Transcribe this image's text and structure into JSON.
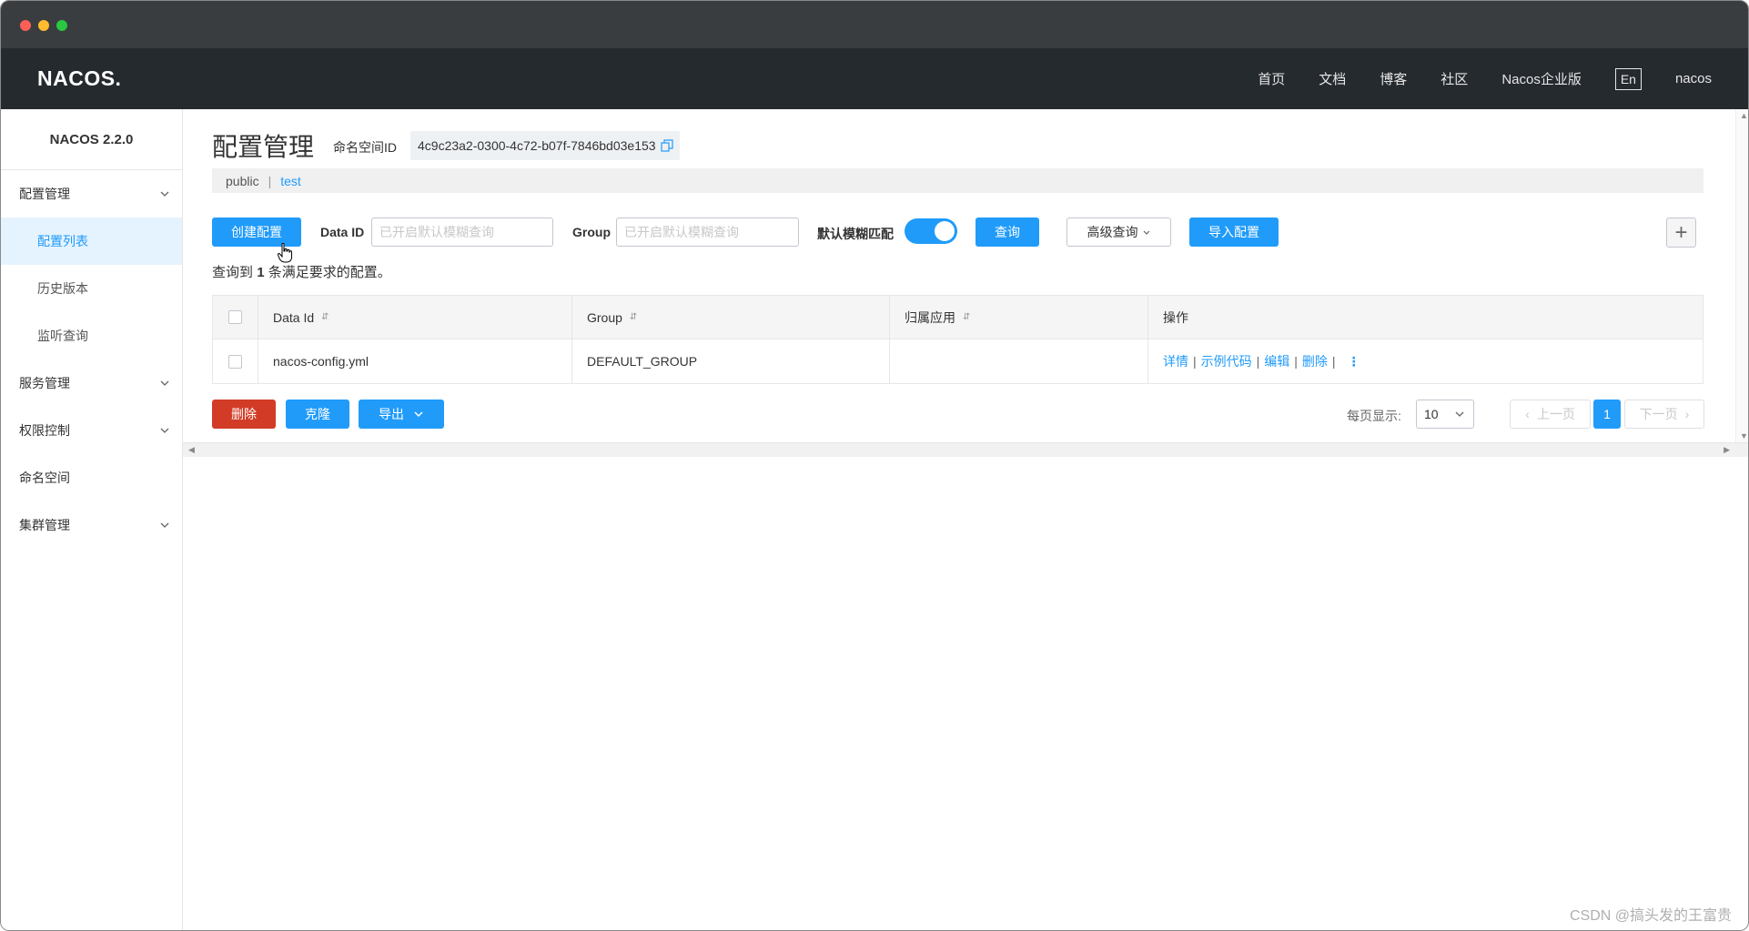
{
  "topnav": {
    "logo_text": "NACOS.",
    "links": [
      "首页",
      "文档",
      "博客",
      "社区",
      "Nacos企业版"
    ],
    "lang_label": "En",
    "user_label": "nacos"
  },
  "sidebar": {
    "version": "NACOS 2.2.0",
    "items": [
      {
        "label": "配置管理",
        "expandable": true
      },
      {
        "label": "配置列表",
        "active": true
      },
      {
        "label": "历史版本"
      },
      {
        "label": "监听查询"
      },
      {
        "label": "服务管理",
        "expandable": true
      },
      {
        "label": "权限控制",
        "expandable": true
      },
      {
        "label": "命名空间"
      },
      {
        "label": "集群管理",
        "expandable": true
      }
    ]
  },
  "header": {
    "title": "配置管理",
    "namespace_label": "命名空间ID",
    "namespace_id": "4c9c23a2-0300-4c72-b07f-7846bd03e153"
  },
  "namespaces": {
    "public": "public",
    "separator": "|",
    "test": "test"
  },
  "search": {
    "create_button": "创建配置",
    "data_id_label": "Data ID",
    "data_id_placeholder": "已开启默认模糊查询",
    "group_label": "Group",
    "group_placeholder": "已开启默认模糊查询",
    "fuzzy_label": "默认模糊匹配",
    "fuzzy_enabled": true,
    "query_button": "查询",
    "advanced_button": "高级查询",
    "import_button": "导入配置",
    "plus_symbol": "+"
  },
  "result": {
    "prefix": "查询到",
    "count": "1",
    "suffix": "条满足要求的配置。"
  },
  "table": {
    "headers": [
      "Data Id",
      "Group",
      "归属应用",
      "操作"
    ],
    "rows": [
      {
        "data_id": "nacos-config.yml",
        "group": "DEFAULT_GROUP",
        "app": "",
        "ops": [
          "详情",
          "示例代码",
          "编辑",
          "删除"
        ]
      }
    ],
    "op_separator": "|"
  },
  "actions": {
    "delete_button": "删除",
    "clone_button": "克隆",
    "export_button": "导出"
  },
  "pagination": {
    "page_size_label": "每页显示:",
    "page_size": "10",
    "prev_label": "上一页",
    "current_page": "1",
    "next_label": "下一页"
  },
  "watermark": "CSDN @搞头发的王富贵",
  "colors": {
    "primary": "#209bfa",
    "danger": "#d23c26",
    "nav_bg": "#252a2f",
    "titlebar_bg": "#3a3d40"
  }
}
